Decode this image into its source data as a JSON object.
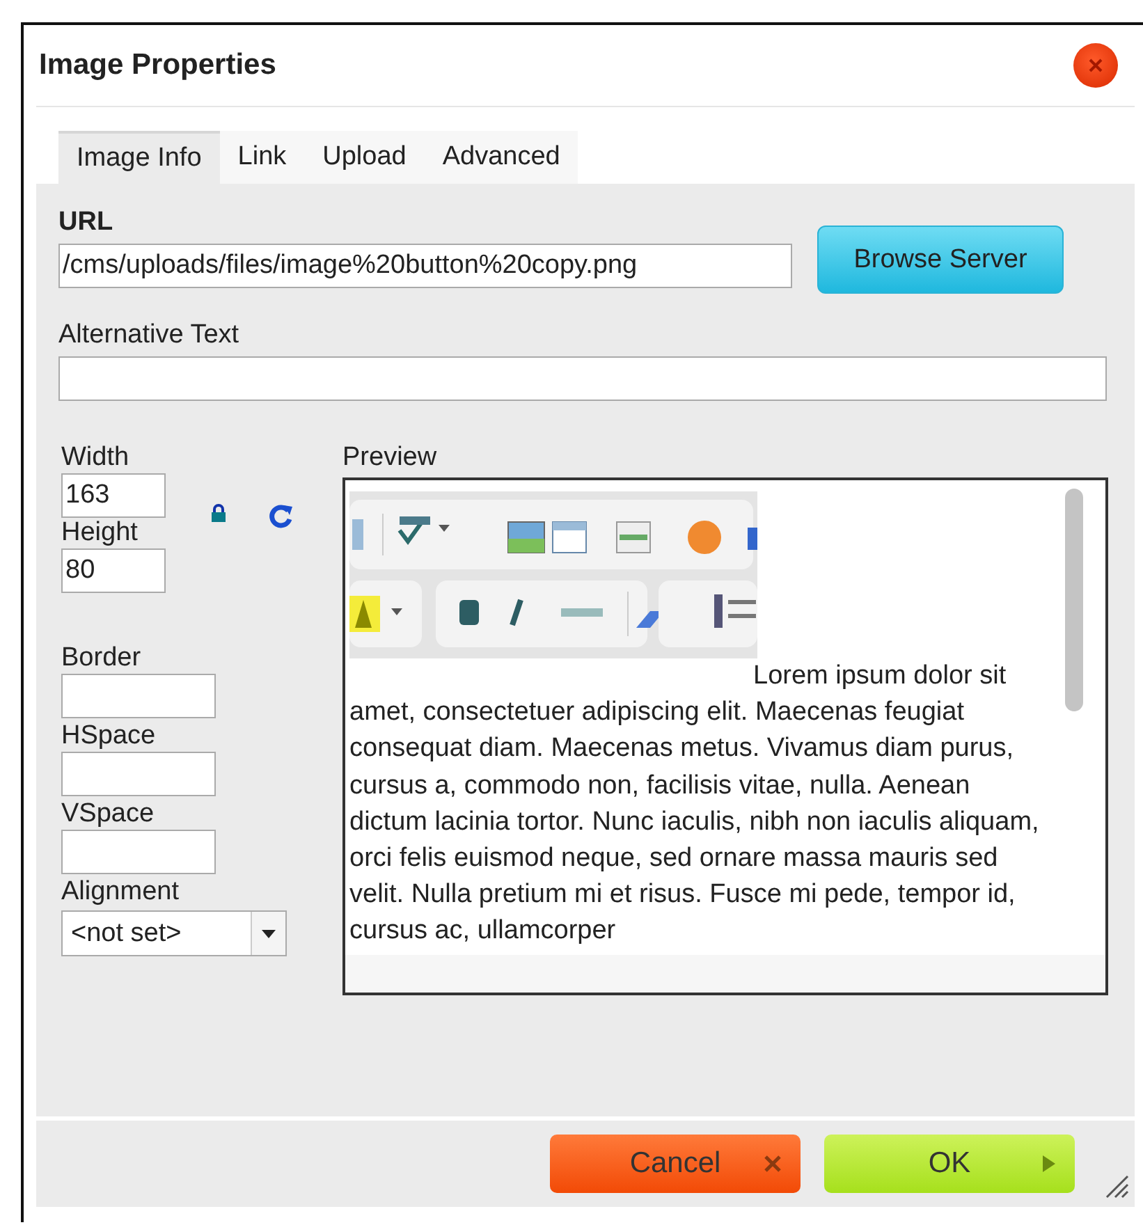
{
  "dialog": {
    "title": "Image Properties"
  },
  "tabs": [
    {
      "label": "Image Info",
      "selected": true
    },
    {
      "label": "Link",
      "selected": false
    },
    {
      "label": "Upload",
      "selected": false
    },
    {
      "label": "Advanced",
      "selected": false
    }
  ],
  "url": {
    "label": "URL",
    "value": "/cms/uploads/files/image%20button%20copy.png"
  },
  "browse_button": "Browse Server",
  "alt_text": {
    "label": "Alternative Text"
  },
  "size_fields": [
    {
      "label": "Width",
      "value": "163"
    },
    {
      "label": "Height",
      "value": "80"
    }
  ],
  "spacing_fields": [
    {
      "label": "Border"
    },
    {
      "label": "HSpace"
    },
    {
      "label": "VSpace"
    }
  ],
  "alignment": {
    "label": "Alignment",
    "value": "<not set>"
  },
  "preview": {
    "label": "Preview",
    "text": "Lorem ipsum dolor sit amet, consectetuer adipiscing elit. Maecenas feugiat consequat diam. Maecenas metus. Vivamus diam purus, cursus a, commodo non, facilisis vitae, nulla. Aenean dictum lacinia tortor. Nunc iaculis, nibh non iaculis aliquam, orci felis euismod neque, sed ornare massa mauris sed velit. Nulla pretium mi et risus. Fusce mi pede, tempor id, cursus ac, ullamcorper"
  },
  "buttons": [
    {
      "label": "Cancel",
      "kind": "cancel"
    },
    {
      "label": "OK",
      "kind": "ok"
    }
  ]
}
